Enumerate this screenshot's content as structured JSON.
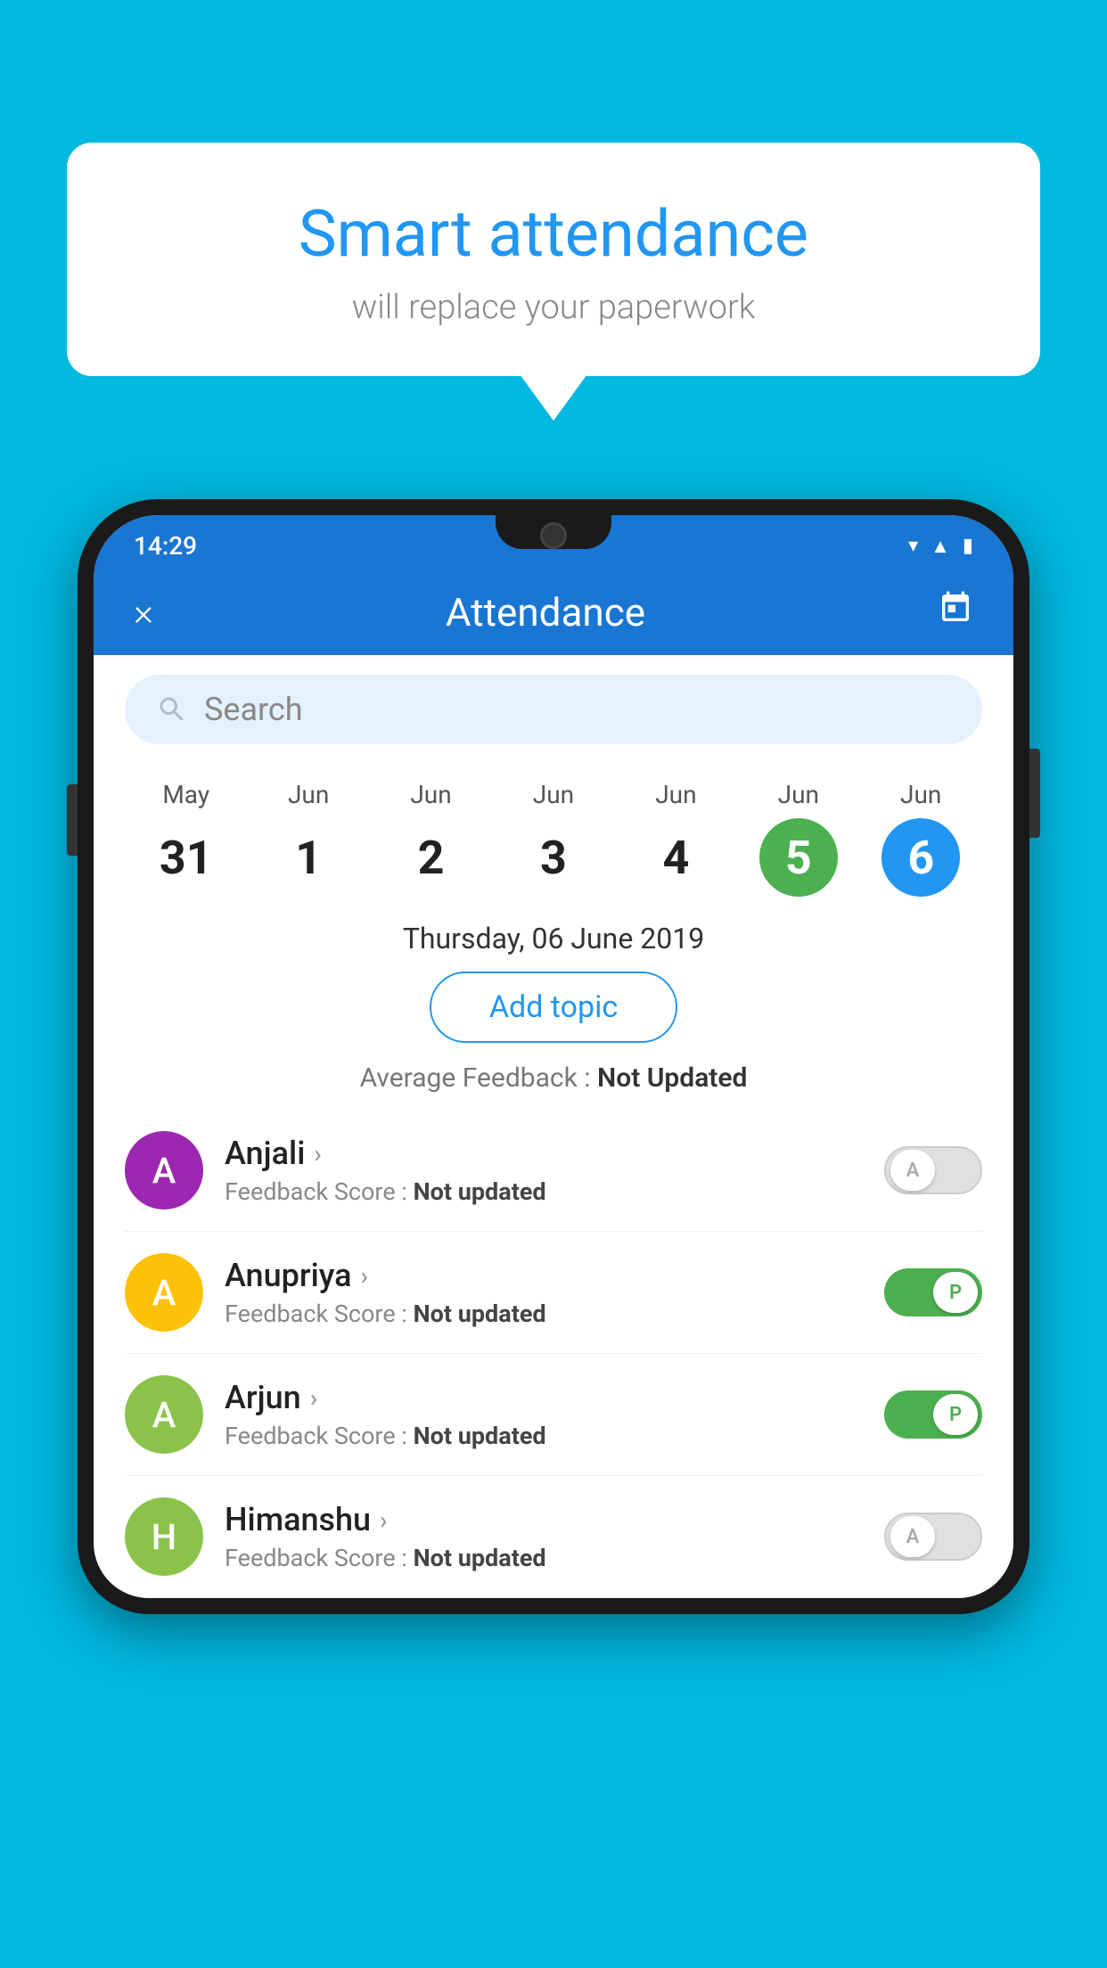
{
  "background_color": "#00B8E0",
  "bubble": {
    "title": "Smart attendance",
    "subtitle": "will replace your paperwork"
  },
  "status_bar": {
    "time": "14:29",
    "icons": [
      "wifi",
      "signal",
      "battery"
    ]
  },
  "app_bar": {
    "close_label": "×",
    "title": "Attendance",
    "calendar_icon": "📅"
  },
  "search": {
    "placeholder": "Search"
  },
  "dates": [
    {
      "month": "May",
      "day": "31",
      "state": "normal"
    },
    {
      "month": "Jun",
      "day": "1",
      "state": "normal"
    },
    {
      "month": "Jun",
      "day": "2",
      "state": "normal"
    },
    {
      "month": "Jun",
      "day": "3",
      "state": "normal"
    },
    {
      "month": "Jun",
      "day": "4",
      "state": "normal"
    },
    {
      "month": "Jun",
      "day": "5",
      "state": "today"
    },
    {
      "month": "Jun",
      "day": "6",
      "state": "selected"
    }
  ],
  "selected_date_label": "Thursday, 06 June 2019",
  "add_topic_label": "Add topic",
  "avg_feedback_label": "Average Feedback : ",
  "avg_feedback_value": "Not Updated",
  "students": [
    {
      "name": "Anjali",
      "avatar_letter": "A",
      "avatar_color": "#9C27B0",
      "feedback_label": "Feedback Score : ",
      "feedback_value": "Not updated",
      "toggle_state": "off",
      "toggle_label": "A"
    },
    {
      "name": "Anupriya",
      "avatar_letter": "A",
      "avatar_color": "#FFC107",
      "feedback_label": "Feedback Score : ",
      "feedback_value": "Not updated",
      "toggle_state": "on",
      "toggle_label": "P"
    },
    {
      "name": "Arjun",
      "avatar_letter": "A",
      "avatar_color": "#8BC34A",
      "feedback_label": "Feedback Score : ",
      "feedback_value": "Not updated",
      "toggle_state": "on",
      "toggle_label": "P"
    },
    {
      "name": "Himanshu",
      "avatar_letter": "H",
      "avatar_color": "#8BC34A",
      "feedback_label": "Feedback Score : ",
      "feedback_value": "Not updated",
      "toggle_state": "off",
      "toggle_label": "A"
    }
  ]
}
